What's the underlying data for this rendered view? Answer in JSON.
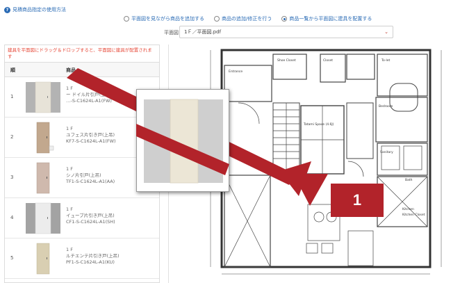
{
  "help": {
    "icon": "question-icon",
    "label": "見積商品指定の使用方法"
  },
  "mode_options": [
    {
      "label": "平面図を見ながら商品を追加する",
      "selected": false
    },
    {
      "label": "商品の追加/修正を行う",
      "selected": false
    },
    {
      "label": "商品一覧から平面図に建具を配置する",
      "selected": true
    }
  ],
  "plan": {
    "label": "平面図",
    "value": "1Ｆ／平面図.pdf"
  },
  "notice": "建具を平面図にドラッグ＆ドロップすると、平面図に建具が配置されます",
  "table": {
    "headers": [
      "順",
      "商品"
    ],
    "rows": [
      {
        "num": "1",
        "floor": "1 F",
        "name": "ー ドイル片引戸(上吊)",
        "code": "…-S-C1624L-A1(FW)",
        "color": "#e7e3d8"
      },
      {
        "num": "2",
        "floor": "1 F",
        "name": "ユフェス片引き戸(上吊)",
        "code": "KF7-S-C1624L-A1(FW)",
        "color": "#c2a88e"
      },
      {
        "num": "3",
        "floor": "1 F",
        "name": "シノ片引戸(上吊)",
        "code": "TF1-S-C1624L-A1(AA)",
        "color": "#cfb9ad"
      },
      {
        "num": "4",
        "floor": "1 F",
        "name": "イューブ片引き戸(上吊)",
        "code": "CF1-S-C1624L-A1(SH)",
        "color": "#d8d8d8"
      },
      {
        "num": "5",
        "floor": "1 F",
        "name": "ルチエンテ片引き戸(上吊)",
        "code": "PF1-S-C1624L-A1(KU)",
        "color": "#d9cfb2"
      }
    ]
  },
  "floorplan": {
    "rooms": [
      "Entrance",
      "Shoe Closet",
      "Closet",
      "To-let",
      "Bedroom",
      "Tatami Space (4.6J)",
      "Sanitary",
      "Bath",
      "Kitchen",
      "Kitchen Closet"
    ]
  },
  "callout": "1",
  "colors": {
    "accent": "#b2232a",
    "link": "#2a6bb5",
    "notice": "#e74c3c"
  }
}
